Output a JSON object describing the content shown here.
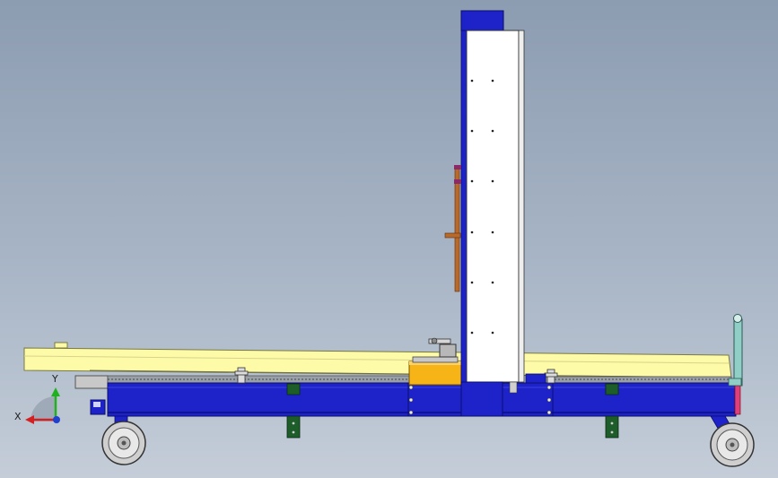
{
  "viewport": {
    "background_top": "#8c9cb1",
    "background_bottom": "#c4cdd8"
  },
  "colors": {
    "frame_blue": "#1d23c9",
    "frame_blue_dark": "#10149a",
    "column_white": "#ffffff",
    "platform_yellow": "#fdfaa8",
    "jack_orange": "#f6b417",
    "handle_teal": "#8fcfc5",
    "foot_green": "#1d5d2a",
    "rod_brown": "#b86a2a"
  },
  "triad": {
    "x_label": "X",
    "y_label": "Y",
    "x_color": "#d42020",
    "y_color": "#20b020",
    "z_color": "#2040d0"
  },
  "icons": {
    "triad": "coordinate-triad-icon",
    "wheel": "caster-wheel-icon",
    "handwheel": "handwheel-icon"
  }
}
